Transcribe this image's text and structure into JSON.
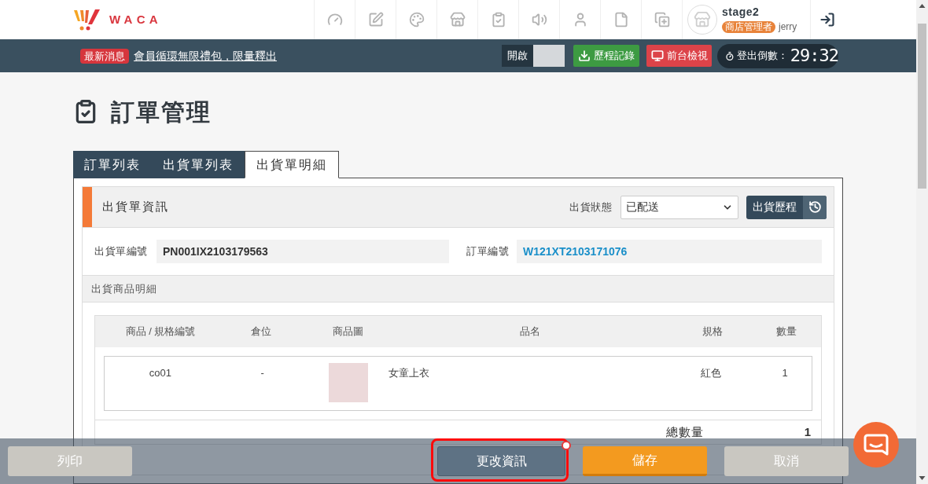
{
  "header": {
    "logo": "WACA",
    "user": {
      "store": "stage2",
      "role": "商店管理者",
      "name": "jerry"
    }
  },
  "news_bar": {
    "badge": "最新消息",
    "headline": "會員循環無限禮包，限量釋出",
    "toggle": {
      "label": "開啟",
      "on": false
    },
    "buttons": [
      {
        "label": "歷程記錄",
        "kind": "history"
      },
      {
        "label": "前台檢視",
        "kind": "preview"
      }
    ],
    "countdown": {
      "label": "登出倒數：",
      "time": "29:32"
    }
  },
  "page_title": "訂單管理",
  "tabs": [
    {
      "label": "訂單列表",
      "selected": false
    },
    {
      "label": "出貨單列表",
      "selected": false
    },
    {
      "label": "出貨單明細",
      "selected": true
    }
  ],
  "shipment_info": {
    "title": "出貨單資訊",
    "status": {
      "label": "出貨狀態",
      "value": "已配送"
    },
    "history_button": "出貨歷程",
    "fields": [
      {
        "label": "出貨單編號",
        "value": "PN001IX2103179563",
        "kind": "text"
      },
      {
        "label": "訂單編號",
        "value": "W121XT2103171076",
        "kind": "link"
      }
    ]
  },
  "items": {
    "title": "出貨商品明細",
    "table": {
      "columns": [
        "商品 / 規格編號",
        "倉位",
        "商品圖",
        "品名",
        "規格",
        "數量"
      ],
      "rows": [
        {
          "sku": "co01",
          "location": "-",
          "name": "女童上衣",
          "spec": "紅色",
          "quantity": "1"
        }
      ]
    },
    "total": {
      "label": "總數量",
      "value": "1"
    }
  },
  "footer_buttons": [
    {
      "label": "列印",
      "kind": "print",
      "highlighted": false
    },
    {
      "label": "更改資訊",
      "kind": "edit",
      "highlighted": true
    },
    {
      "label": "儲存",
      "kind": "save",
      "highlighted": false
    },
    {
      "label": "取消",
      "kind": "cancel",
      "highlighted": false
    }
  ]
}
